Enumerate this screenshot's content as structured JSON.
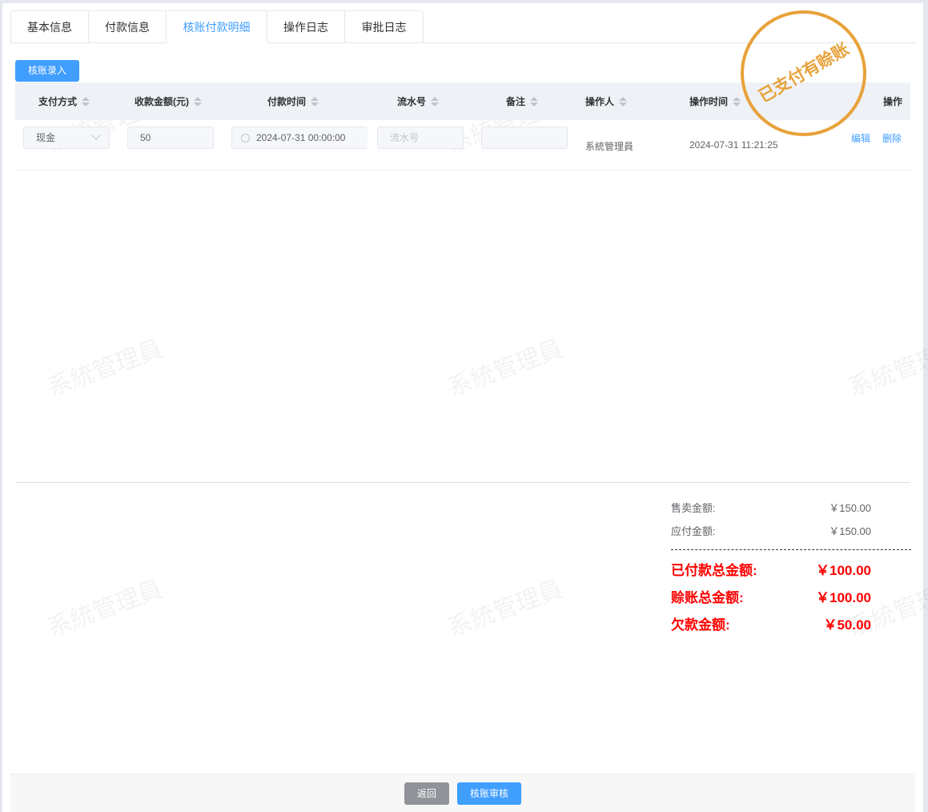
{
  "tabs": [
    "基本信息",
    "付款信息",
    "核账付款明细",
    "操作日志",
    "审批日志"
  ],
  "active_tab": 2,
  "add_button": "核账录入",
  "columns": [
    "支付方式",
    "收款金额(元)",
    "付款时间",
    "流水号",
    "备注",
    "操作人",
    "操作时间",
    "操作"
  ],
  "row": {
    "pay_method": "现金",
    "amount": "50",
    "pay_time": "2024-07-31 00:00:00",
    "serial_placeholder": "流水号",
    "remark": "",
    "operator": "系統管理員",
    "op_time": "2024-07-31 11:21:25",
    "edit": "编辑",
    "delete": "删除"
  },
  "stamp": "已支付有赊账",
  "watermark": "系統管理員",
  "summary": {
    "sale_label": "售卖金额:",
    "sale_value": "￥150.00",
    "payable_label": "应付金额:",
    "payable_value": "￥150.00",
    "paid_label": "已付款总金额:",
    "paid_value": "￥100.00",
    "credit_label": "赊账总金额:",
    "credit_value": "￥100.00",
    "owed_label": "欠款金额:",
    "owed_value": "￥50.00"
  },
  "footer": {
    "back": "返回",
    "audit": "核账审核"
  },
  "colors": {
    "primary": "#409eff",
    "stamp": "#e8a23a",
    "red": "#ff0000"
  }
}
